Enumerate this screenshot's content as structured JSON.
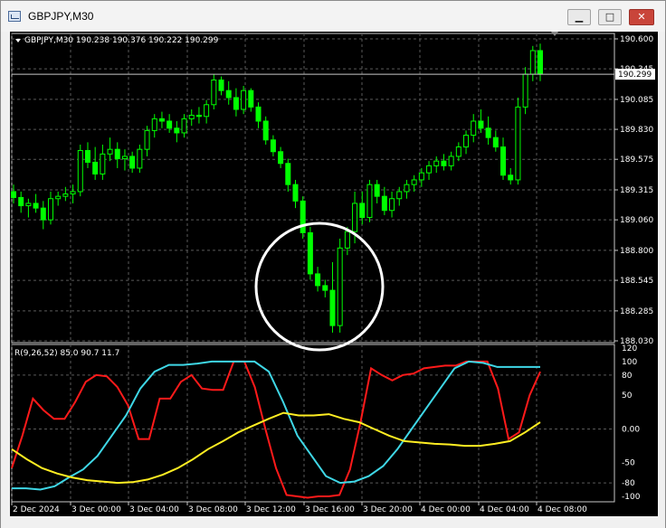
{
  "window": {
    "title": "GBPJPY,M30",
    "minimize_glyph": "▁",
    "maximize_glyph": "□",
    "close_glyph": "✕",
    "icon": "chart-window-icon"
  },
  "main_chart": {
    "header": "GBPJPY,M30  190.238 190.376 190.222 190.299",
    "current_price": "190.299",
    "price_labels": [
      "190.600",
      "190.345",
      "190.085",
      "189.830",
      "189.575",
      "189.315",
      "189.060",
      "188.800",
      "188.545",
      "188.285",
      "188.030"
    ],
    "colors": {
      "bull": "#00ff00",
      "bear": "#000000",
      "grid": "#5a5a5a",
      "axis_text": "#ffffff",
      "annotation_circle": "#ffffff"
    }
  },
  "indicator": {
    "header": "R(9,26,52) 85.0 90.7 11.7",
    "levels": [
      "120",
      "100",
      "80",
      "50",
      "0.00",
      "-50",
      "-80",
      "-100"
    ],
    "colors": {
      "red": "#ff1a1a",
      "cyan": "#3fd7e6",
      "yellow": "#ffee22"
    }
  },
  "time_axis": [
    "2 Dec 2024",
    "3 Dec 00:00",
    "3 Dec 04:00",
    "3 Dec 08:00",
    "3 Dec 12:00",
    "3 Dec 16:00",
    "3 Dec 20:00",
    "4 Dec 00:00",
    "4 Dec 04:00",
    "4 Dec 08:00"
  ],
  "chart_data": [
    {
      "type": "candlestick",
      "title": "GBPJPY,M30",
      "y_ticks": [
        190.6,
        190.345,
        190.085,
        189.83,
        189.575,
        189.315,
        189.06,
        188.8,
        188.545,
        188.285,
        188.03
      ],
      "ylim": [
        188.03,
        190.6
      ],
      "x_tick_labels": [
        "2 Dec 2024",
        "3 Dec 00:00",
        "3 Dec 04:00",
        "3 Dec 08:00",
        "3 Dec 12:00",
        "3 Dec 16:00",
        "3 Dec 20:00",
        "4 Dec 00:00",
        "4 Dec 04:00",
        "4 Dec 08:00"
      ],
      "grid": true,
      "candles_ohlc": [
        [
          189.3,
          189.36,
          189.2,
          189.25
        ],
        [
          189.25,
          189.3,
          189.12,
          189.18
        ],
        [
          189.18,
          189.24,
          189.08,
          189.2
        ],
        [
          189.2,
          189.28,
          189.12,
          189.16
        ],
        [
          189.16,
          189.22,
          188.98,
          189.06
        ],
        [
          189.06,
          189.3,
          189.02,
          189.24
        ],
        [
          189.24,
          189.3,
          189.18,
          189.26
        ],
        [
          189.26,
          189.34,
          189.22,
          189.28
        ],
        [
          189.28,
          189.36,
          189.2,
          189.3
        ],
        [
          189.3,
          189.7,
          189.26,
          189.65
        ],
        [
          189.65,
          189.72,
          189.5,
          189.55
        ],
        [
          189.55,
          189.68,
          189.4,
          189.45
        ],
        [
          189.45,
          189.7,
          189.4,
          189.62
        ],
        [
          189.62,
          189.76,
          189.56,
          189.66
        ],
        [
          189.66,
          189.72,
          189.5,
          189.58
        ],
        [
          189.58,
          189.66,
          189.48,
          189.6
        ],
        [
          189.6,
          189.64,
          189.46,
          189.5
        ],
        [
          189.5,
          189.7,
          189.46,
          189.66
        ],
        [
          189.66,
          189.86,
          189.6,
          189.82
        ],
        [
          189.82,
          189.96,
          189.76,
          189.92
        ],
        [
          189.92,
          189.98,
          189.84,
          189.9
        ],
        [
          189.9,
          189.96,
          189.8,
          189.84
        ],
        [
          189.84,
          189.9,
          189.72,
          189.8
        ],
        [
          189.8,
          189.96,
          189.76,
          189.92
        ],
        [
          189.92,
          190.0,
          189.86,
          189.95
        ],
        [
          189.95,
          190.02,
          189.88,
          189.94
        ],
        [
          189.94,
          190.08,
          189.88,
          190.04
        ],
        [
          190.04,
          190.3,
          190.0,
          190.25
        ],
        [
          190.25,
          190.28,
          190.12,
          190.16
        ],
        [
          190.16,
          190.24,
          190.04,
          190.1
        ],
        [
          190.1,
          190.18,
          189.94,
          190.0
        ],
        [
          190.0,
          190.2,
          189.96,
          190.16
        ],
        [
          190.16,
          190.18,
          189.98,
          190.02
        ],
        [
          190.02,
          190.06,
          189.84,
          189.9
        ],
        [
          189.9,
          189.94,
          189.7,
          189.74
        ],
        [
          189.74,
          189.78,
          189.6,
          189.64
        ],
        [
          189.64,
          189.68,
          189.5,
          189.54
        ],
        [
          189.54,
          189.58,
          189.3,
          189.36
        ],
        [
          189.36,
          189.4,
          189.16,
          189.22
        ],
        [
          189.22,
          189.26,
          188.9,
          188.95
        ],
        [
          188.95,
          189.0,
          188.55,
          188.6
        ],
        [
          188.6,
          188.66,
          188.45,
          188.5
        ],
        [
          188.5,
          188.55,
          188.4,
          188.46
        ],
        [
          188.46,
          188.7,
          188.1,
          188.16
        ],
        [
          188.16,
          188.9,
          188.1,
          188.82
        ],
        [
          188.82,
          189.0,
          188.76,
          188.96
        ],
        [
          188.96,
          189.3,
          188.86,
          189.2
        ],
        [
          189.2,
          189.3,
          189.02,
          189.08
        ],
        [
          189.08,
          189.4,
          189.04,
          189.36
        ],
        [
          189.36,
          189.4,
          189.2,
          189.26
        ],
        [
          189.26,
          189.34,
          189.1,
          189.14
        ],
        [
          189.14,
          189.3,
          189.08,
          189.24
        ],
        [
          189.24,
          189.34,
          189.18,
          189.3
        ],
        [
          189.3,
          189.4,
          189.24,
          189.36
        ],
        [
          189.36,
          189.44,
          189.3,
          189.4
        ],
        [
          189.4,
          189.5,
          189.34,
          189.46
        ],
        [
          189.46,
          189.56,
          189.4,
          189.52
        ],
        [
          189.52,
          189.6,
          189.46,
          189.56
        ],
        [
          189.56,
          189.62,
          189.48,
          189.52
        ],
        [
          189.52,
          189.64,
          189.48,
          189.6
        ],
        [
          189.6,
          189.72,
          189.56,
          189.68
        ],
        [
          189.68,
          189.82,
          189.62,
          189.78
        ],
        [
          189.78,
          189.96,
          189.72,
          189.9
        ],
        [
          189.9,
          190.0,
          189.8,
          189.84
        ],
        [
          189.84,
          189.94,
          189.7,
          189.76
        ],
        [
          189.76,
          189.82,
          189.64,
          189.68
        ],
        [
          189.68,
          189.76,
          189.4,
          189.44
        ],
        [
          189.44,
          189.5,
          189.36,
          189.4
        ],
        [
          189.4,
          190.1,
          189.36,
          190.02
        ],
        [
          190.02,
          190.36,
          189.96,
          190.3
        ],
        [
          190.3,
          190.54,
          190.24,
          190.5
        ],
        [
          190.5,
          190.56,
          190.24,
          190.3
        ]
      ]
    },
    {
      "type": "line",
      "title": "R(9,26,52) 85.0 90.7 11.7",
      "ylim": [
        -100,
        120
      ],
      "y_ticks": [
        120,
        100,
        80,
        50,
        0,
        -50,
        -80,
        -100
      ],
      "series": [
        {
          "color": "#ff1a1a",
          "values": [
            -58,
            -10,
            45,
            28,
            15,
            15,
            40,
            70,
            80,
            78,
            62,
            35,
            -15,
            -15,
            45,
            45,
            70,
            80,
            60,
            58,
            58,
            100,
            100,
            62,
            0,
            -58,
            -98,
            -100,
            -102,
            -100,
            -100,
            -98,
            -60,
            10,
            90,
            80,
            72,
            80,
            82,
            90,
            92,
            94,
            94,
            100,
            100,
            100,
            60,
            -15,
            -5,
            50,
            85
          ]
        },
        {
          "color": "#3fd7e6",
          "values": [
            -88,
            -88,
            -90,
            -85,
            -72,
            -60,
            -40,
            -10,
            20,
            60,
            85,
            95,
            95,
            97,
            100,
            100,
            100,
            100,
            85,
            40,
            -10,
            -40,
            -70,
            -80,
            -78,
            -70,
            -55,
            -30,
            0,
            30,
            60,
            90,
            100,
            98,
            92,
            92,
            92,
            92
          ]
        },
        {
          "color": "#ffee22",
          "values": [
            -30,
            -45,
            -58,
            -66,
            -72,
            -76,
            -78,
            -80,
            -79,
            -75,
            -68,
            -58,
            -45,
            -30,
            -18,
            -5,
            5,
            15,
            24,
            20,
            20,
            22,
            15,
            10,
            0,
            -10,
            -18,
            -20,
            -22,
            -23,
            -25,
            -25,
            -22,
            -18,
            -5,
            10
          ]
        }
      ]
    }
  ]
}
